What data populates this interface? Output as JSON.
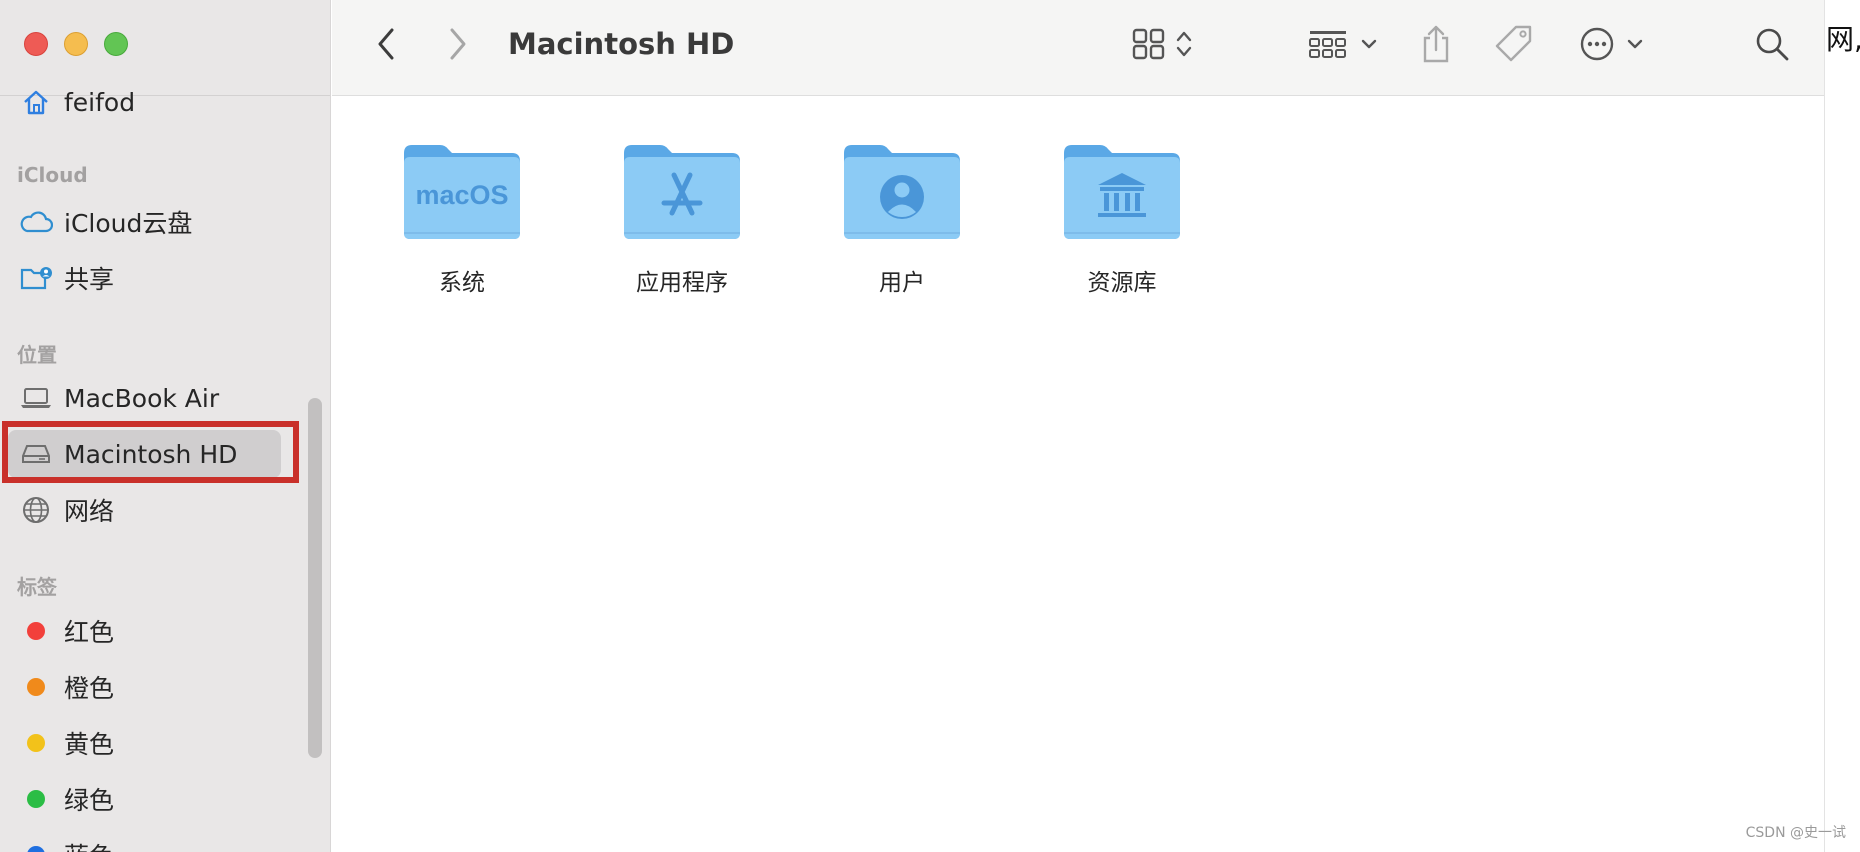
{
  "window": {
    "title": "Macintosh HD"
  },
  "sidebar": {
    "favorites_partial": {
      "label": "feifod",
      "icon": "home-icon"
    },
    "sections": {
      "icloud": "iCloud",
      "locations": "位置",
      "tags": "标签"
    },
    "icloud_items": [
      {
        "label": "iCloud云盘",
        "icon": "cloud-icon"
      },
      {
        "label": "共享",
        "icon": "shared-folder-icon"
      }
    ],
    "location_items": [
      {
        "label": "MacBook Air",
        "icon": "laptop-icon"
      },
      {
        "label": "Macintosh HD",
        "icon": "hard-drive-icon",
        "selected": true
      },
      {
        "label": "网络",
        "icon": "globe-icon"
      }
    ],
    "tag_items": [
      {
        "label": "红色",
        "color": "#f2403b"
      },
      {
        "label": "橙色",
        "color": "#f08a1b"
      },
      {
        "label": "黄色",
        "color": "#f2c21a"
      },
      {
        "label": "绿色",
        "color": "#2bbd45"
      },
      {
        "label": "蓝色",
        "color": "#1f6fe0"
      }
    ]
  },
  "toolbar": {
    "back": "chevron-left-icon",
    "forward": "chevron-right-icon",
    "view_toggle": "grid-view-icon",
    "group": "group-icon",
    "share": "share-icon",
    "tag": "tag-icon",
    "more": "ellipsis-circle-icon",
    "search": "search-icon"
  },
  "folders": [
    {
      "name": "系统",
      "badge": "macOS",
      "icon": "macos-folder-icon"
    },
    {
      "name": "应用程序",
      "icon": "applications-folder-icon"
    },
    {
      "name": "用户",
      "icon": "users-folder-icon"
    },
    {
      "name": "资源库",
      "icon": "library-folder-icon"
    }
  ],
  "edge_text": "网,",
  "watermark": "CSDN @史一试",
  "colors": {
    "folder": "#8ccbf5",
    "folder_tab": "#5aa8e6",
    "accent_red": "#c9302a"
  }
}
